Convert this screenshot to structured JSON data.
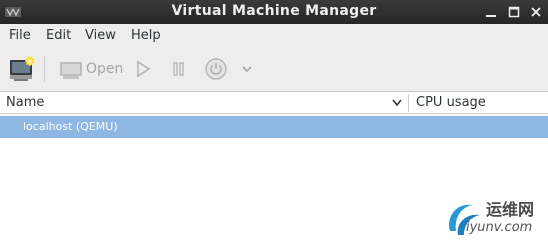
{
  "window": {
    "title": "Virtual Machine Manager"
  },
  "menubar": {
    "items": [
      "File",
      "Edit",
      "View",
      "Help"
    ]
  },
  "toolbar": {
    "open_label": "Open"
  },
  "columns": {
    "name": "Name",
    "cpu_usage": "CPU usage"
  },
  "connections": [
    {
      "label": "localhost (QEMU)",
      "selected": true
    }
  ],
  "watermark": {
    "cn": "运维网",
    "url": "iyunv.com"
  },
  "colors": {
    "titlebar": "#2f2f2f",
    "selection": "#8fb7e3",
    "toolbar_bg": "#ededed"
  }
}
